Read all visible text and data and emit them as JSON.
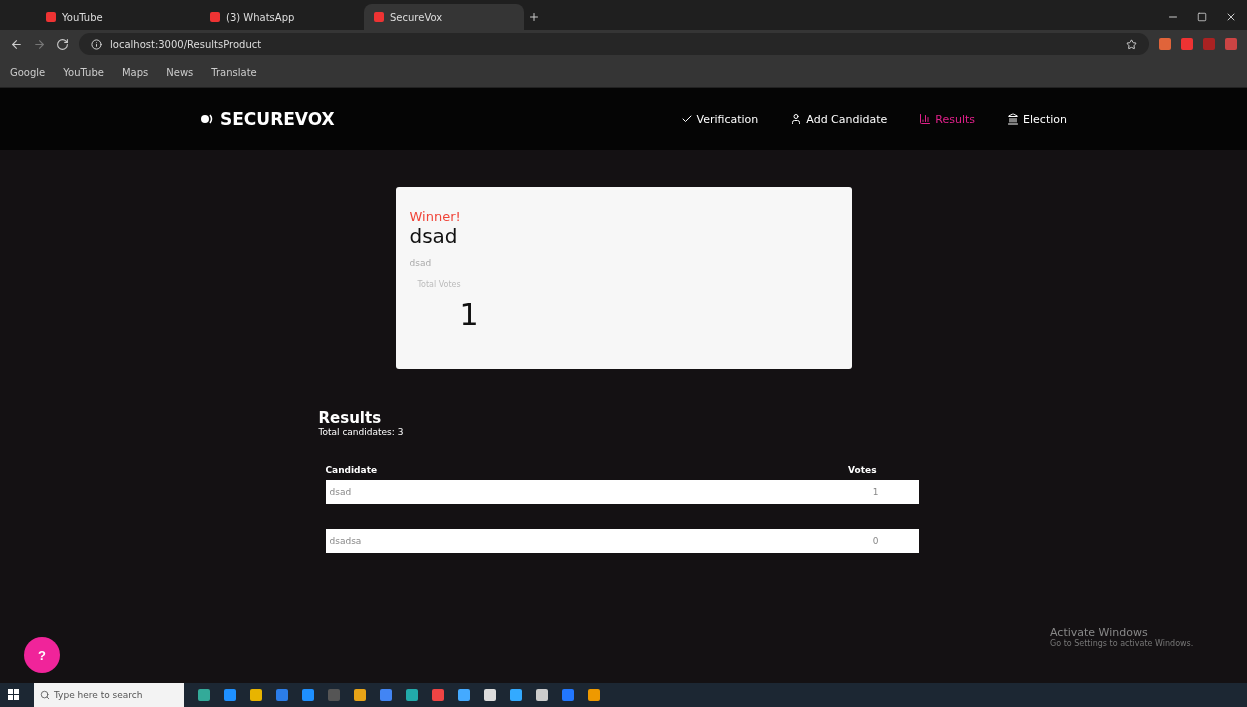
{
  "browser": {
    "tabs": [
      {
        "title": "YouTube",
        "selected": false
      },
      {
        "title": "(3) WhatsApp",
        "selected": false
      },
      {
        "title": "SecureVox",
        "selected": true
      }
    ],
    "url": "localhost:3000/ResultsProduct",
    "bookmarks": [
      "Google",
      "YouTube",
      "Maps",
      "News",
      "Translate"
    ]
  },
  "nav": {
    "brand": "SECUREVOX",
    "links": [
      {
        "label": "Verification",
        "selected": false
      },
      {
        "label": "Add Candidate",
        "selected": false
      },
      {
        "label": "Results",
        "selected": true
      },
      {
        "label": "Election",
        "selected": false
      }
    ]
  },
  "winner": {
    "label": "Winner!",
    "name": "dsad",
    "party": "dsad",
    "votes_label": "Total Votes",
    "votes": "1"
  },
  "results": {
    "title": "Results",
    "subtitle": "Total candidates: 3",
    "columns": [
      "Candidate",
      "Votes"
    ],
    "rows": [
      {
        "candidate": "dsad",
        "votes": "1"
      },
      {
        "candidate": "dsadsa",
        "votes": "0"
      }
    ]
  },
  "help": "?",
  "activation": {
    "title": "Activate Windows",
    "subtitle": "Go to Settings to activate Windows."
  },
  "taskbar": {
    "search_placeholder": "Type here to search"
  }
}
